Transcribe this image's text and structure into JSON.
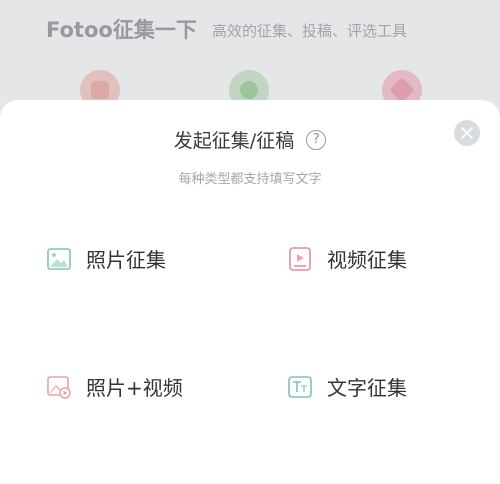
{
  "background": {
    "title": "Fotoo征集一下",
    "subtitle": "高效的征集、投稿、评选工具"
  },
  "sheet": {
    "title": "发起征集/征稿",
    "help_icon": "?",
    "subtitle": "每种类型都支持填写文字",
    "options": [
      {
        "label": "照片征集",
        "icon": "image-icon",
        "color": "#7fc7b0"
      },
      {
        "label": "视频征集",
        "icon": "video-icon",
        "color": "#e48aa5"
      },
      {
        "label": "照片+视频",
        "icon": "photo-video-icon",
        "color": "#e8a3a8"
      },
      {
        "label": "文字征集",
        "icon": "text-icon",
        "color": "#7fbfb8"
      }
    ]
  }
}
